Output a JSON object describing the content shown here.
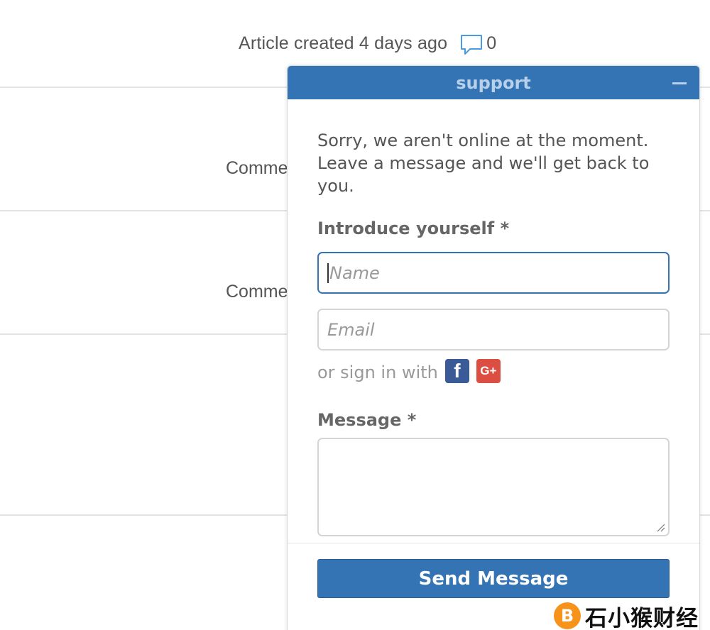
{
  "article": {
    "meta_text": "Article created 4 days ago",
    "comment_count": "0",
    "row_labels": [
      "Comme",
      "Comme"
    ]
  },
  "widget": {
    "title": "support",
    "offline_message": "Sorry, we aren't online at the moment. Leave a message and we'll get back to you.",
    "introduce_label": "Introduce yourself *",
    "name_placeholder": "Name",
    "email_placeholder": "Email",
    "signin_text": "or sign in with",
    "facebook_glyph": "f",
    "google_glyph": "G+",
    "message_label": "Message *",
    "send_label": "Send Message"
  },
  "watermark": {
    "logo_glyph": "B",
    "text": "石小猴财经"
  },
  "colors": {
    "accent": "#3574b4",
    "facebook": "#3b5b98",
    "google": "#dc4e41",
    "watermark_logo": "#f7931a"
  }
}
